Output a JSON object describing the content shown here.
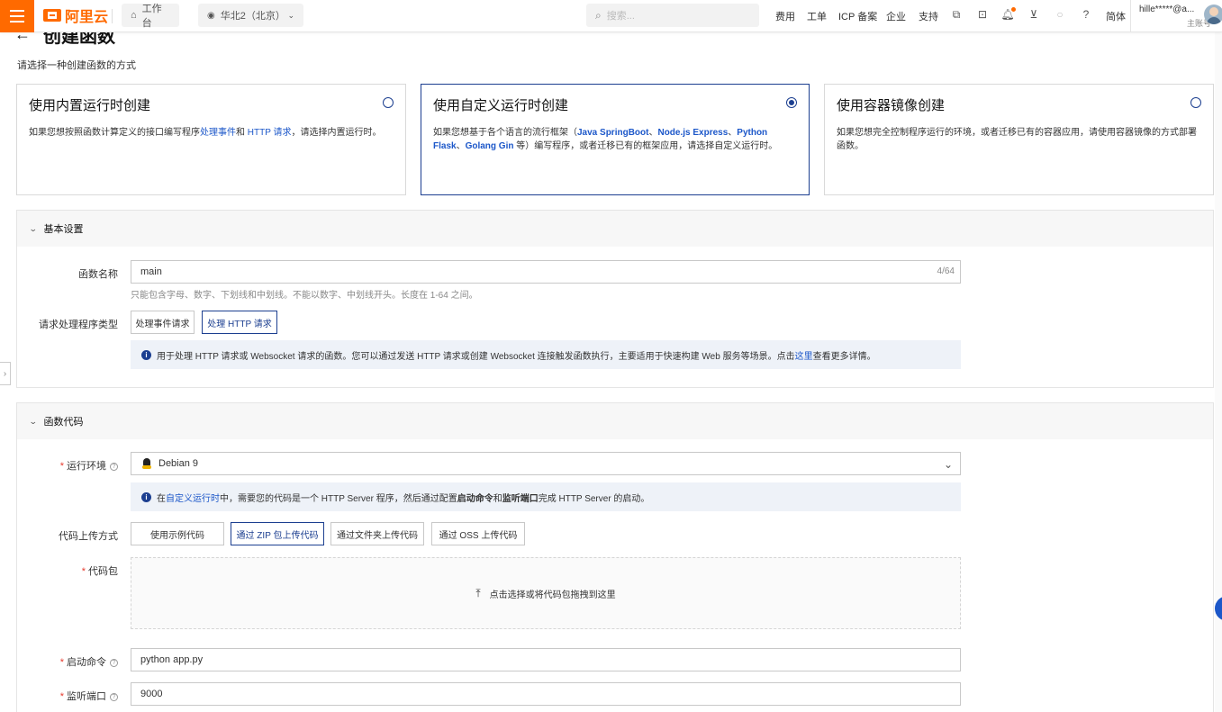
{
  "topbar": {
    "logo": "阿里云",
    "workbench": "工作台",
    "region": "华北2（北京）",
    "search_placeholder": "搜索...",
    "nav": [
      "费用",
      "工单",
      "ICP 备案",
      "企业",
      "支持"
    ],
    "lang": "简体",
    "user_name": "hille*****@a...",
    "user_role": "主账号"
  },
  "page": {
    "title": "创建函数",
    "subtitle": "请选择一种创建函数的方式"
  },
  "modes": [
    {
      "title": "使用内置运行时创建",
      "desc_1": "如果您想按照函数计算定义的接口编写程序",
      "desc_link_1": "处理事件",
      "desc_2": "和 ",
      "desc_link_2": "HTTP 请求",
      "desc_3": "，请选择内置运行时。",
      "selected": false
    },
    {
      "title": "使用自定义运行时创建",
      "desc_1": "如果您想基于各个语言的流行框架（",
      "fw_1": "Java SpringBoot",
      "sep_1": "、",
      "fw_2": "Node.js Express",
      "sep_2": "、",
      "fw_3": "Python Flask",
      "sep_3": "、",
      "fw_4": "Golang Gin",
      "desc_2": " 等）编写程序，或者迁移已有的框架应用，请选择自定义运行时。",
      "selected": true
    },
    {
      "title": "使用容器镜像创建",
      "desc": "如果您想完全控制程序运行的环境，或者迁移已有的容器应用，请使用容器镜像的方式部署函数。",
      "selected": false
    }
  ],
  "basic": {
    "heading": "基本设置",
    "name_label": "函数名称",
    "name_value": "main",
    "name_counter": "4/64",
    "name_hint": "只能包含字母、数字、下划线和中划线。不能以数字、中划线开头。长度在 1-64 之间。",
    "handler_label": "请求处理程序类型",
    "handler_opt_event": "处理事件请求",
    "handler_opt_http": "处理 HTTP 请求",
    "info_text": "用于处理 HTTP 请求或 Websocket 请求的函数。您可以通过发送 HTTP 请求或创建 Websocket 连接触发函数执行，主要适用于快速构建 Web 服务等场景。点击",
    "info_link": "这里",
    "info_tail": "查看更多详情。"
  },
  "code": {
    "heading": "函数代码",
    "runtime_label": "运行环境",
    "runtime_value": "Debian 9",
    "runtime_info_1": "在",
    "runtime_info_link": "自定义运行时",
    "runtime_info_2": "中，需要您的代码是一个 HTTP Server 程序，然后通过配置",
    "runtime_info_b1": "启动命令",
    "runtime_info_3": "和",
    "runtime_info_b2": "监听端口",
    "runtime_info_4": "完成 HTTP Server 的启动。",
    "upload_label": "代码上传方式",
    "upload_opts": [
      "使用示例代码",
      "通过 ZIP 包上传代码",
      "通过文件夹上传代码",
      "通过 OSS 上传代码"
    ],
    "package_label": "代码包",
    "package_drop": "点击选择或将代码包拖拽到这里",
    "start_label": "启动命令",
    "start_value": "python app.py",
    "port_label": "监听端口",
    "port_value": "9000"
  },
  "colors": {
    "brand": "#ff6a00",
    "primary": "#1c3f90",
    "link": "#1c57c9",
    "required": "#e63b2e"
  }
}
